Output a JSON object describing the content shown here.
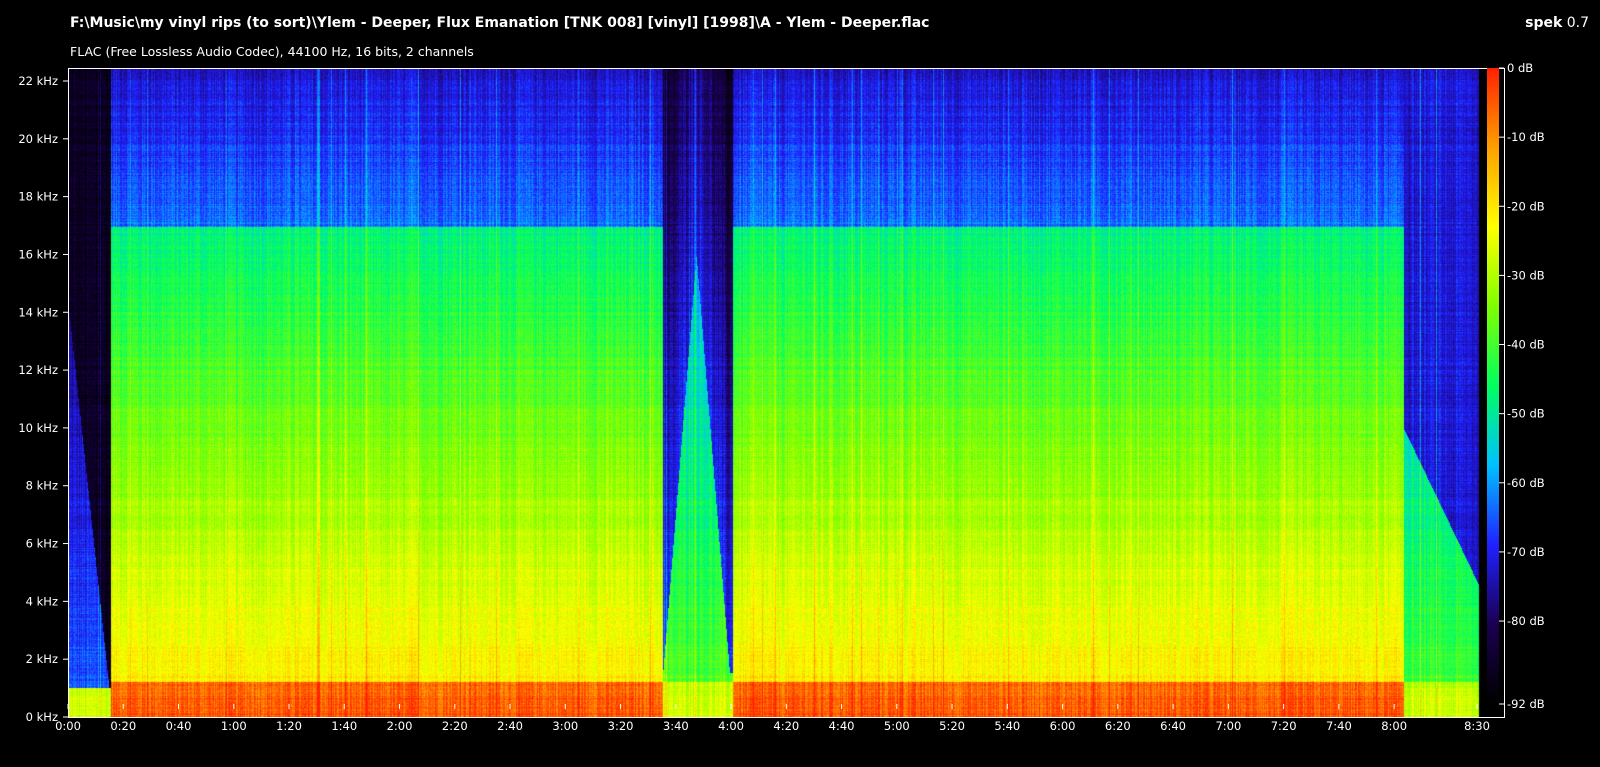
{
  "header": {
    "file_path": "F:\\Music\\my vinyl rips (to sort)\\Ylem - Deeper, Flux Emanation [TNK 008] [vinyl] [1998]\\A - Ylem - Deeper.flac",
    "app_name": "spek",
    "app_version": "0.7",
    "format_info": "FLAC (Free Lossless Audio Codec), 44100 Hz, 16 bits, 2 channels"
  },
  "chart_data": {
    "type": "heatmap",
    "title": "",
    "xlabel": "",
    "ylabel": "",
    "x_ticks": [
      "0:00",
      "0:20",
      "0:40",
      "1:00",
      "1:20",
      "1:40",
      "2:00",
      "2:20",
      "2:40",
      "3:00",
      "3:20",
      "3:40",
      "4:00",
      "4:20",
      "4:40",
      "5:00",
      "5:20",
      "5:40",
      "6:00",
      "6:20",
      "6:40",
      "7:00",
      "7:20",
      "7:40",
      "8:00",
      "8:30"
    ],
    "x_tick_seconds": [
      0,
      20,
      40,
      60,
      80,
      100,
      120,
      140,
      160,
      180,
      200,
      220,
      240,
      260,
      280,
      300,
      320,
      340,
      360,
      380,
      400,
      420,
      440,
      460,
      480,
      510
    ],
    "xlim_seconds": [
      0,
      510
    ],
    "y_ticks": [
      "0 kHz",
      "2 kHz",
      "4 kHz",
      "6 kHz",
      "8 kHz",
      "10 kHz",
      "12 kHz",
      "14 kHz",
      "16 kHz",
      "18 kHz",
      "20 kHz",
      "22 kHz"
    ],
    "y_tick_khz": [
      0,
      2,
      4,
      6,
      8,
      10,
      12,
      14,
      16,
      18,
      20,
      22
    ],
    "ylim_khz": [
      0,
      22
    ],
    "colorbar_ticks": [
      "0 dB",
      "-10 dB",
      "-20 dB",
      "-30 dB",
      "-40 dB",
      "-50 dB",
      "-60 dB",
      "-70 dB",
      "-80 dB",
      "-92 dB"
    ],
    "colorbar_db": [
      0,
      -10,
      -20,
      -30,
      -40,
      -50,
      -60,
      -70,
      -80,
      -92
    ],
    "colorbar_range_db": [
      -92,
      0
    ],
    "colormap": [
      "#000000",
      "#1a0050",
      "#2020ff",
      "#00c0ff",
      "#00ff60",
      "#80ff00",
      "#ffff00",
      "#ffa000",
      "#ff2000"
    ],
    "quiet_segments_seconds": [
      [
        0,
        15
      ],
      [
        215,
        240
      ],
      [
        483,
        510
      ]
    ],
    "notes_on_shape": "loud broadband content with energy concentrated below 2 kHz; high band above ~17 kHz mostly dark blue"
  }
}
